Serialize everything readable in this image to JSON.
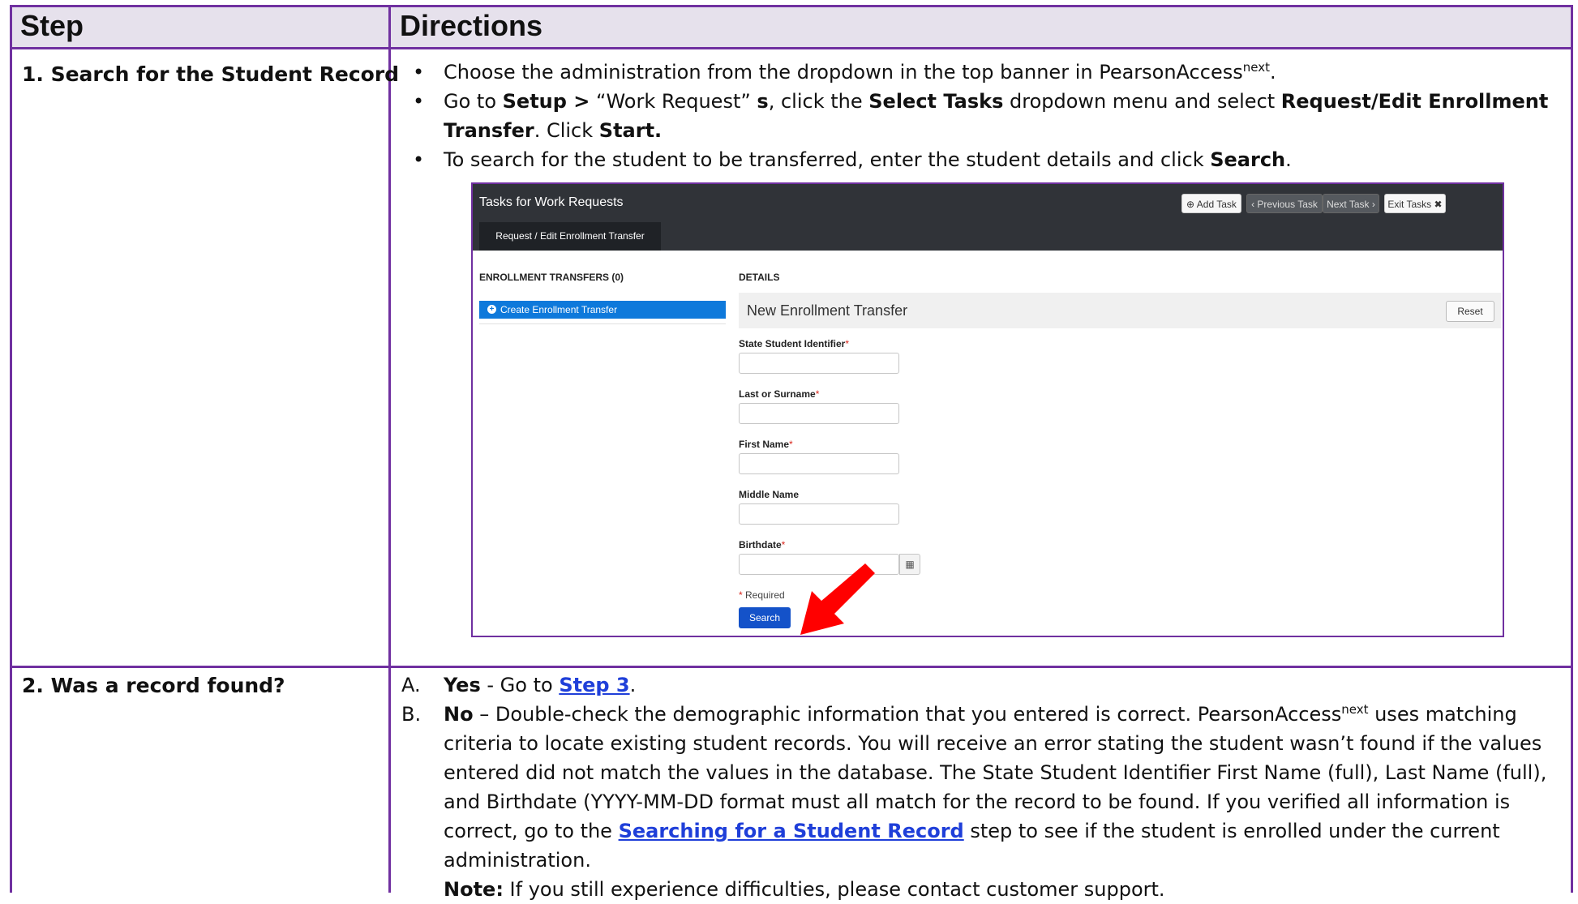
{
  "header": {
    "step": "Step",
    "directions": "Directions"
  },
  "row1": {
    "step_label": "1.   Search for the Student Record",
    "b1_pre": "Choose the administration from the dropdown in the top banner in PearsonAccess",
    "b1_sup": "next",
    "b1_post": ".",
    "b2_pre": "Go to ",
    "b2_setup": "Setup >",
    "b2_mid1": " “Work Request” ",
    "b2_s": "s",
    "b2_mid2": ", click the ",
    "b2_select_tasks": "Select Tasks",
    "b2_mid3": " dropdown menu and select ",
    "b2_request": "Request/Edit Enrollment Transfer",
    "b2_mid4": ". Click ",
    "b2_start": "Start.",
    "b3_pre": "To search for the student to be transferred, enter the student details and click ",
    "b3_search": "Search",
    "b3_post": "."
  },
  "screenshot": {
    "bar_title": "Tasks for Work Requests",
    "add_task": "Add Task",
    "previous_task": "Previous Task",
    "next_task": "Next Task",
    "exit_tasks": "Exit Tasks",
    "subtab": "Request / Edit Enrollment Transfer",
    "left_heading": "ENROLLMENT TRANSFERS (0)",
    "create_button": "Create Enrollment Transfer",
    "details_heading": "DETAILS",
    "details_title": "New Enrollment Transfer",
    "reset": "Reset",
    "fields": {
      "ssid": "State Student Identifier",
      "last": "Last or Surname",
      "first": "First Name",
      "middle": "Middle Name",
      "birth": "Birthdate"
    },
    "required_mark": "*",
    "required_note": "Required",
    "search_button": "Search",
    "colors": {
      "bar": "#303338",
      "create": "#0e79db",
      "search": "#1452c9",
      "arrow": "#ff0000"
    }
  },
  "row2": {
    "step_label": "2.   Was a record found?",
    "a_letter": "A.",
    "a_yes": "Yes",
    "a_mid": " - Go to ",
    "a_link": "Step 3",
    "a_post": ".",
    "b_letter": "B.",
    "b_no": "No",
    "b_text1": " – Double-check the demographic information that you entered is correct. PearsonAccess",
    "b_sup": "next",
    "b_text2": " uses matching criteria to locate existing student records. You will receive an error stating the student wasn’t found if the values entered did not match the values in the database. The State Student Identifier First Name (full), Last Name (full), and Birthdate (YYYY-MM-DD format must all match for the record to be found. If you verified all information is correct, go to the ",
    "b_link": "Searching for a Student Record",
    "b_text3": " step to see if the student is enrolled under the current administration.",
    "note_label": "Note:",
    "note_text": " If you still experience difficulties, please contact customer support."
  },
  "theme": {
    "border": "#7030a0",
    "header_bg": "#e6e1ec",
    "link": "#1f3fd9"
  }
}
